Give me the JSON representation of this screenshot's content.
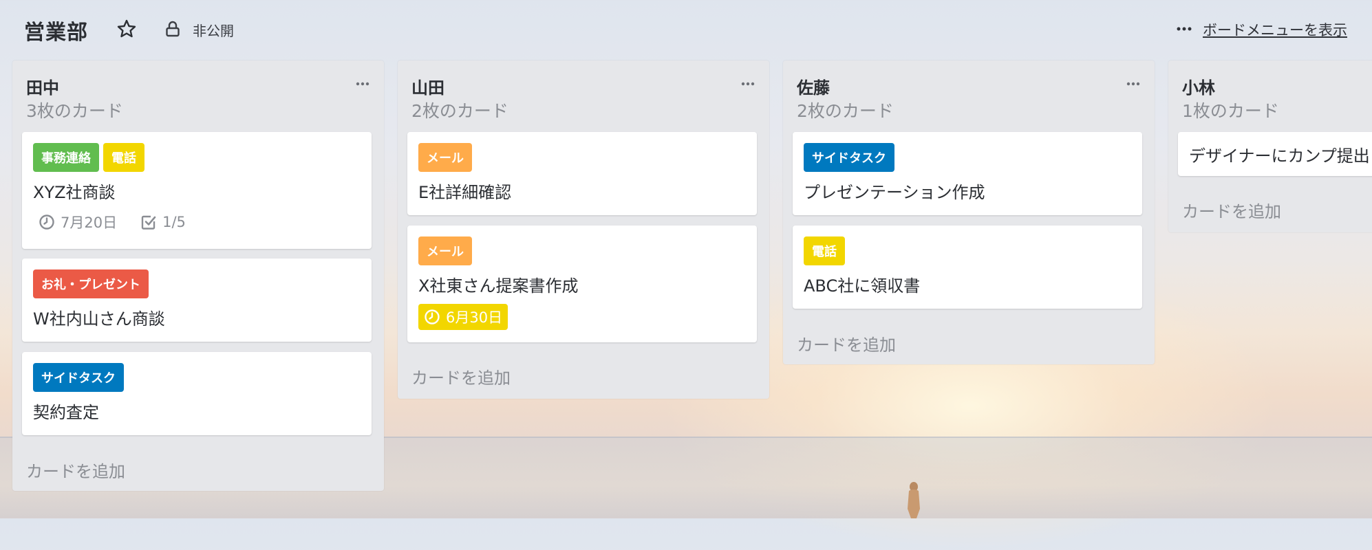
{
  "board": {
    "title": "営業部",
    "visibility": "非公開",
    "menu_link": "ボードメニューを表示"
  },
  "colors": {
    "green": "#61bd4f",
    "yellow": "#f2d600",
    "orange": "#ffab4a",
    "red": "#eb5a46",
    "blue": "#0079bf"
  },
  "lists": [
    {
      "title": "田中",
      "count": "3枚のカード",
      "add_card": "カードを追加",
      "cards": [
        {
          "labels": [
            "事務連絡",
            "電話"
          ],
          "title": "XYZ社商談",
          "due": "7月20日",
          "checklist": "1/5"
        },
        {
          "labels": [
            "お礼・プレゼント"
          ],
          "title": "W社内山さん商談"
        },
        {
          "labels": [
            "サイドタスク"
          ],
          "title": "契約査定"
        }
      ]
    },
    {
      "title": "山田",
      "count": "2枚のカード",
      "add_card": "カードを追加",
      "cards": [
        {
          "labels": [
            "メール"
          ],
          "title": "E社詳細確認"
        },
        {
          "labels": [
            "メール"
          ],
          "title": "X社東さん提案書作成",
          "due": "6月30日"
        }
      ]
    },
    {
      "title": "佐藤",
      "count": "2枚のカード",
      "add_card": "カードを追加",
      "cards": [
        {
          "labels": [
            "サイドタスク"
          ],
          "title": "プレゼンテーション作成"
        },
        {
          "labels": [
            "電話"
          ],
          "title": "ABC社に領収書"
        }
      ]
    },
    {
      "title": "小林",
      "count": "1枚のカード",
      "add_card": "カードを追加",
      "cards": [
        {
          "title": "デザイナーにカンプ提出"
        }
      ]
    }
  ]
}
